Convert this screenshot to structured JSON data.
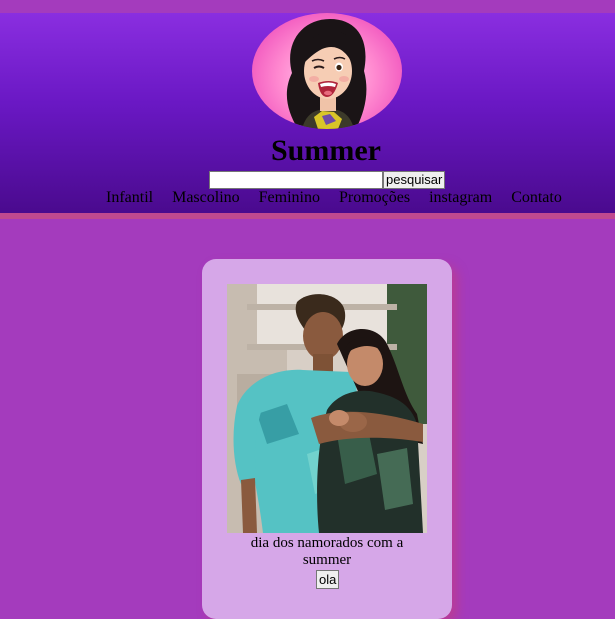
{
  "header": {
    "title": "Summer",
    "logo_icon": "avatar-winking-girl",
    "search": {
      "value": "",
      "placeholder": "",
      "button_label": "pesquisar"
    },
    "nav": [
      {
        "label": "Infantil"
      },
      {
        "label": "Mascolino"
      },
      {
        "label": "Feminino"
      },
      {
        "label": "Promoções"
      },
      {
        "label": "instagram"
      },
      {
        "label": "Contato"
      }
    ]
  },
  "card": {
    "image_icon": "couple-photo",
    "caption": "dia dos namorados com a summer",
    "button_label": "ola"
  },
  "colors": {
    "page_background": "#a43bbd",
    "header_gradient_top": "#8a2ee0",
    "header_gradient_bottom": "#4a0a8e",
    "card_background": "#d6a7e8",
    "logo_pink": "#f25bc0"
  }
}
